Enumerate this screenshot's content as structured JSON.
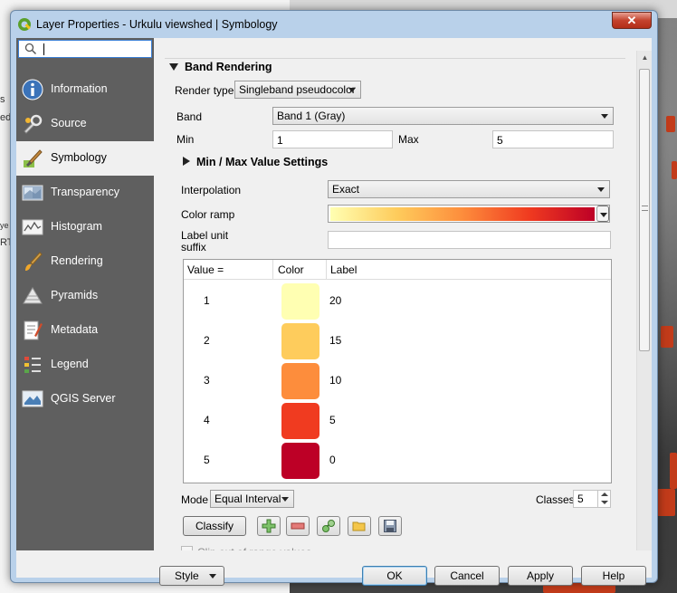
{
  "window": {
    "title": "Layer Properties - Urkulu viewshed | Symbology",
    "close_label": "✕"
  },
  "background": {
    "side_labels": [
      "s",
      "ed",
      "ye",
      "RT"
    ]
  },
  "search": {
    "placeholder": "",
    "value": ""
  },
  "sidebar": {
    "items": [
      {
        "label": "Information",
        "icon": "information-icon",
        "active": false
      },
      {
        "label": "Source",
        "icon": "source-wrench-icon",
        "active": false
      },
      {
        "label": "Symbology",
        "icon": "symbology-brush-icon",
        "active": true
      },
      {
        "label": "Transparency",
        "icon": "transparency-icon",
        "active": false
      },
      {
        "label": "Histogram",
        "icon": "histogram-icon",
        "active": false
      },
      {
        "label": "Rendering",
        "icon": "rendering-brush-icon",
        "active": false
      },
      {
        "label": "Pyramids",
        "icon": "pyramids-icon",
        "active": false
      },
      {
        "label": "Metadata",
        "icon": "metadata-icon",
        "active": false
      },
      {
        "label": "Legend",
        "icon": "legend-icon",
        "active": false
      },
      {
        "label": "QGIS Server",
        "icon": "qgis-server-icon",
        "active": false
      }
    ]
  },
  "band_rendering": {
    "header": "Band Rendering",
    "render_type_label": "Render type",
    "render_type_value": "Singleband pseudocolor",
    "band_label": "Band",
    "band_value": "Band 1 (Gray)",
    "min_label": "Min",
    "min_value": "1",
    "max_label": "Max",
    "max_value": "5",
    "minmax_header": "Min / Max Value Settings",
    "interpolation_label": "Interpolation",
    "interpolation_value": "Exact",
    "color_ramp_label": "Color ramp",
    "color_ramp_colors": [
      "#ffffb2",
      "#fecc5c",
      "#fd8d3c",
      "#f03b20",
      "#bd0026"
    ],
    "label_unit_label_line1": "Label unit",
    "label_unit_label_line2": "suffix",
    "label_unit_value": ""
  },
  "table": {
    "headers": [
      "Value =",
      "Color",
      "Label"
    ],
    "rows": [
      {
        "value": "1",
        "color": "#ffffb2",
        "label": "20"
      },
      {
        "value": "2",
        "color": "#fecc5c",
        "label": "15"
      },
      {
        "value": "3",
        "color": "#fd8d3c",
        "label": "10"
      },
      {
        "value": "4",
        "color": "#f03b20",
        "label": "5"
      },
      {
        "value": "5",
        "color": "#bd0026",
        "label": "0"
      }
    ]
  },
  "classification": {
    "mode_label": "Mode",
    "mode_value": "Equal Interval",
    "classes_label": "Classes",
    "classes_value": "5",
    "classify_label": "Classify",
    "tool_icons": [
      "add-class-icon",
      "remove-class-icon",
      "load-colors-icon",
      "open-folder-icon",
      "save-icon"
    ]
  },
  "clip": {
    "label": "Clip out of range values",
    "checked": false
  },
  "footer": {
    "style_label": "Style",
    "ok_label": "OK",
    "cancel_label": "Cancel",
    "apply_label": "Apply",
    "help_label": "Help"
  }
}
